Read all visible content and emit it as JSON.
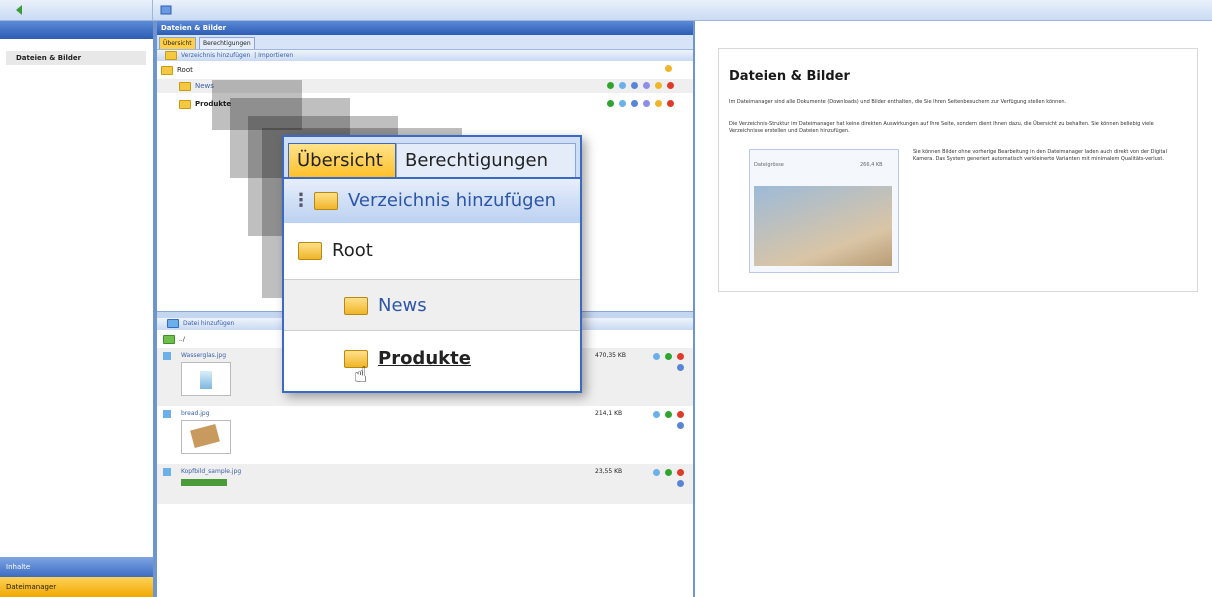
{
  "sidebar": {
    "active_item": "Dateien & Bilder",
    "bottom_items": [
      "Inhalte",
      "Dateimanager"
    ]
  },
  "center": {
    "header_title": "Dateien & Bilder",
    "tabs": [
      "Übersicht",
      "Berechtigungen"
    ],
    "toolbar": {
      "add_folder": "Verzeichnis hinzufügen",
      "import": "Importieren"
    },
    "tree": [
      {
        "label": "Root",
        "level": 0
      },
      {
        "label": "News",
        "level": 1
      },
      {
        "label": "Produkte",
        "level": 1
      }
    ],
    "files_toolbar": {
      "add_file": "Datei hinzufügen"
    },
    "path": "../",
    "files": [
      {
        "name": "Wasserglas.jpg",
        "size": "470,35 KB"
      },
      {
        "name": "bread.jpg",
        "size": "214,1 KB"
      },
      {
        "name": "Kopfbild_sample.jpg",
        "size": "23,55 KB"
      }
    ]
  },
  "zoom": {
    "tabs": [
      "Übersicht",
      "Berechtigungen"
    ],
    "toolbar_label": "Verzeichnis hinzufügen",
    "rows": [
      {
        "label": "Root"
      },
      {
        "label": "News"
      },
      {
        "label": "Produkte"
      }
    ]
  },
  "right": {
    "title": "Dateien & Bilder",
    "p1": "Im Dateimanager sind alle Dokumente (Downloads) und Bilder enthalten, die Sie Ihren Seitenbesuchern zur Verfügung stellen können.",
    "p2": "Die Verzeichnis-Struktur im Dateimanager hat keine direkten Auswirkungen auf Ihre Seite, sondern dient Ihnen dazu, die Übersicht zu behalten. Sie können beliebig viele Verzeichnisse erstellen und Dateien hinzufügen.",
    "p3": "Sie können Bilder ohne vorherige Bearbeitung in den Dateimanager laden auch direkt von der Digital Kamera. Das System generiert automatisch verkleinerte Varianten mit minimalem Qualitäts-verlust.",
    "img_caption_label": "Dateigrösse",
    "img_caption_value": "266,4 KB"
  },
  "colors": {
    "accent_blue": "#2d5cb4",
    "tab_orange": "#ffc02a",
    "folder_yellow": "#f5c842"
  }
}
